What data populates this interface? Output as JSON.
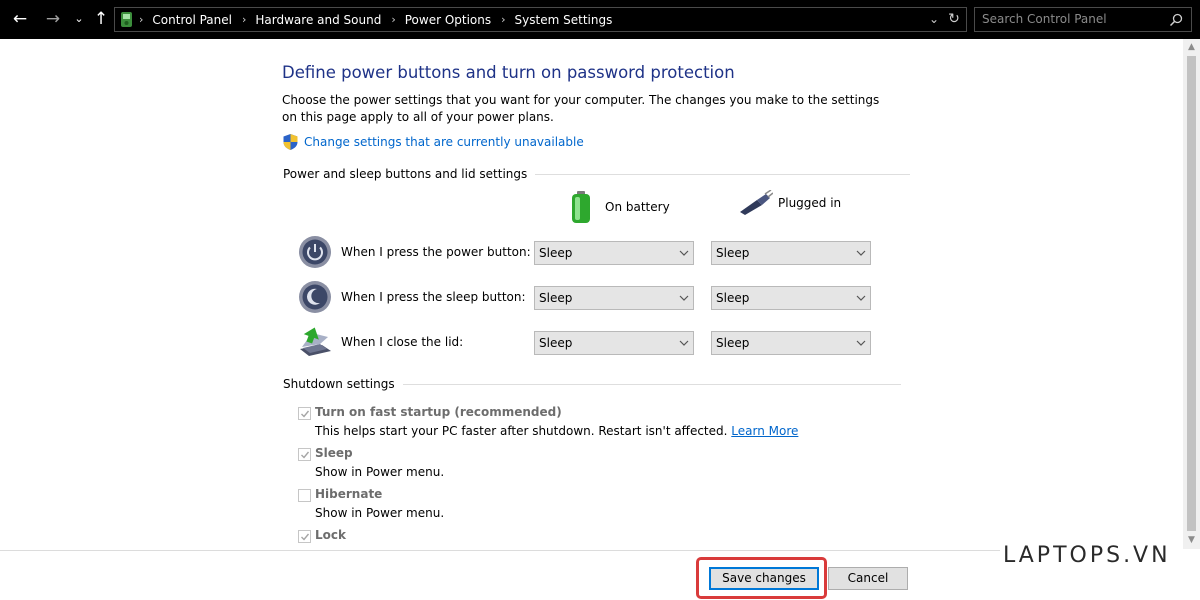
{
  "address_bar": {
    "breadcrumbs": [
      "Control Panel",
      "Hardware and Sound",
      "Power Options",
      "System Settings"
    ],
    "search_placeholder": "Search Control Panel"
  },
  "page": {
    "title": "Define power buttons and turn on password protection",
    "description": "Choose the power settings that you want for your computer. The changes you make to the settings on this page apply to all of your power plans.",
    "uac_link": "Change settings that are currently unavailable"
  },
  "buttons_section": {
    "heading": "Power and sleep buttons and lid settings",
    "columns": {
      "battery": "On battery",
      "plugged": "Plugged in"
    },
    "rows": [
      {
        "label": "When I press the power button:",
        "battery": "Sleep",
        "plugged": "Sleep"
      },
      {
        "label": "When I press the sleep button:",
        "battery": "Sleep",
        "plugged": "Sleep"
      },
      {
        "label": "When I close the lid:",
        "battery": "Sleep",
        "plugged": "Sleep"
      }
    ]
  },
  "shutdown_section": {
    "heading": "Shutdown settings",
    "options": [
      {
        "label": "Turn on fast startup (recommended)",
        "desc": "This helps start your PC faster after shutdown. Restart isn't affected.",
        "link": "Learn More",
        "checked": true
      },
      {
        "label": "Sleep",
        "desc": "Show in Power menu.",
        "checked": true
      },
      {
        "label": "Hibernate",
        "desc": "Show in Power menu.",
        "checked": false
      },
      {
        "label": "Lock",
        "checked": true
      }
    ]
  },
  "footer": {
    "save_label": "Save changes",
    "cancel_label": "Cancel"
  },
  "watermark": "LAPTOPS.VN",
  "colors": {
    "title": "#1e3287",
    "link": "#0066cc",
    "highlight": "#d93b3b",
    "focus": "#0078d7"
  }
}
